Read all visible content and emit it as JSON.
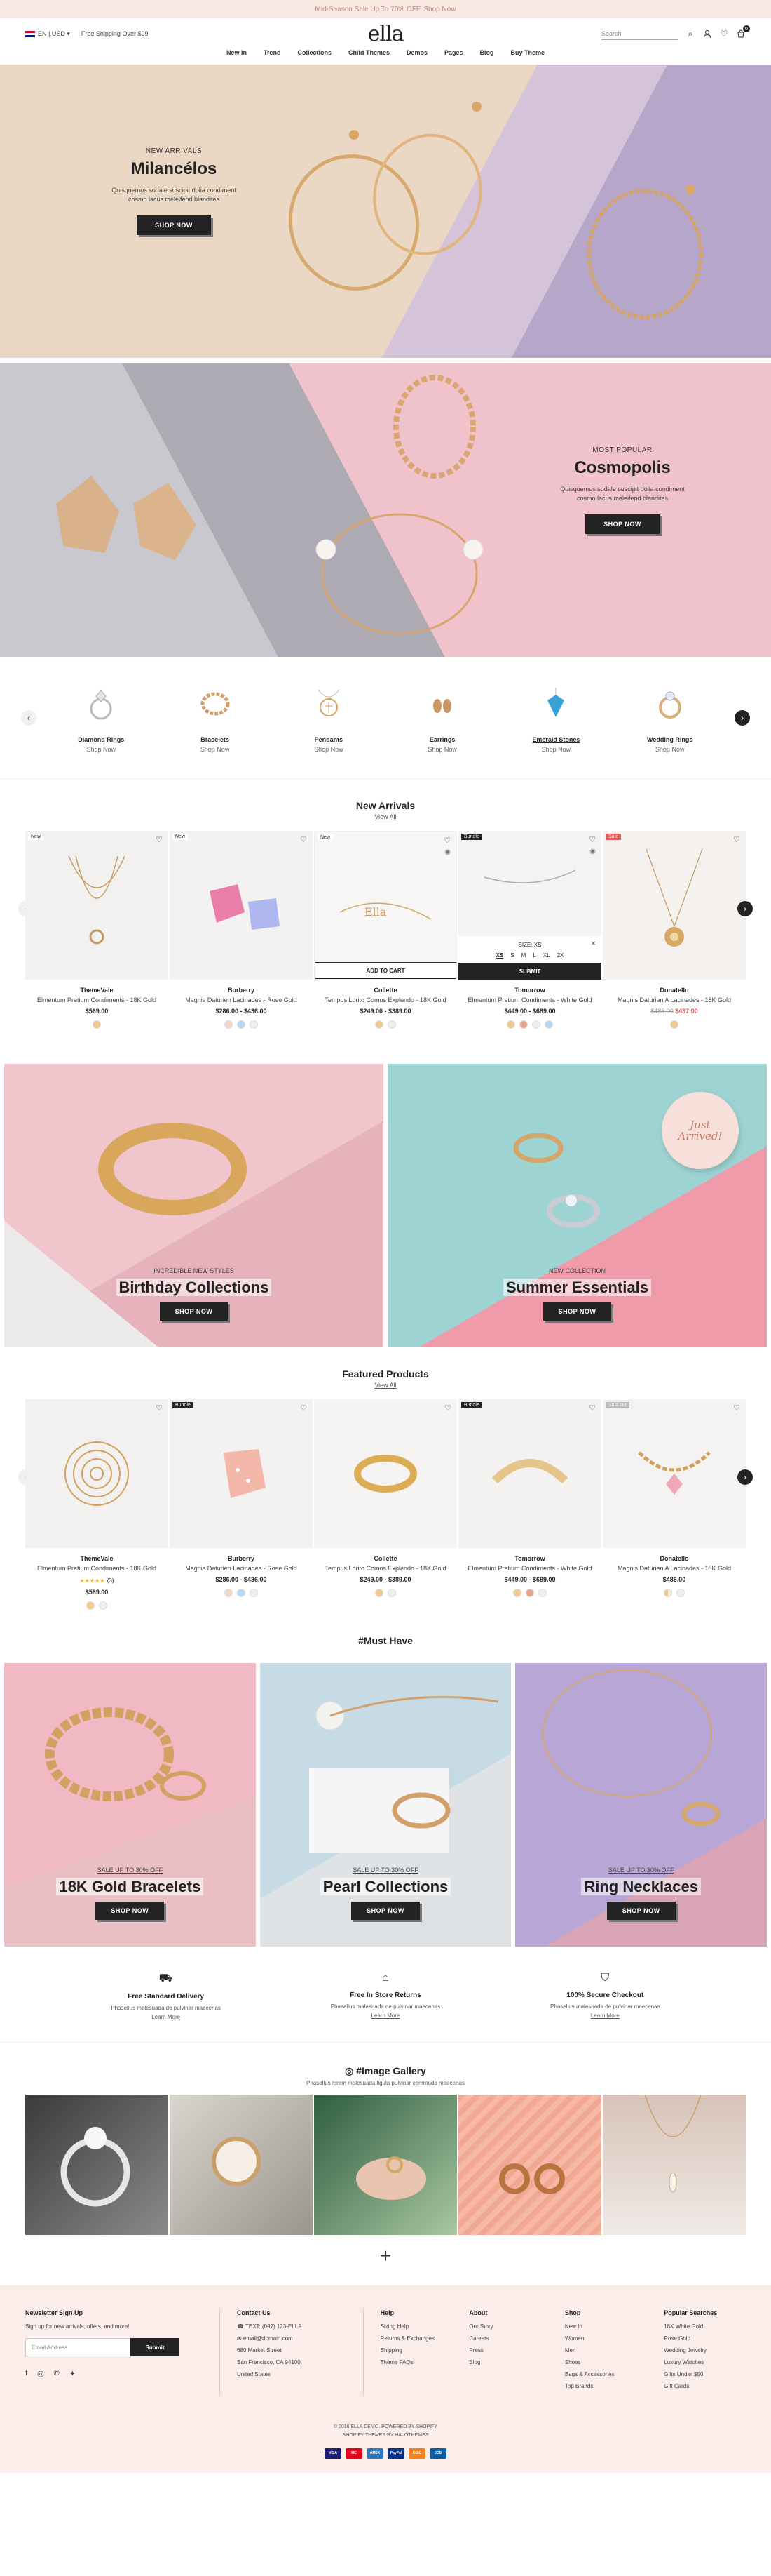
{
  "topbar": {
    "announcement": "Mid-Season Sale Up To 70% OFF. Shop Now"
  },
  "header": {
    "language": "EN",
    "currency": "USD",
    "shipping": "Free Shipping Over $99",
    "logo": "ella",
    "search_placeholder": "Search",
    "cart_count": "0"
  },
  "nav": [
    "New In",
    "Trend",
    "Collections",
    "Child Themes",
    "Demos",
    "Pages",
    "Blog",
    "Buy Theme"
  ],
  "hero1": {
    "sub": "NEW ARRIVALS",
    "title": "Milancélos",
    "text_line1": "Quisquemos sodale suscipit dolia condiment",
    "text_line2": "cosmo lacus meleifend blandites",
    "button": "SHOP NOW"
  },
  "hero2": {
    "sub": "MOST POPULAR",
    "title": "Cosmopolis",
    "text_line1": "Quisquemos sodale suscipit dolia condiment",
    "text_line2": "cosmo lacus meleifend blandites",
    "button": "SHOP NOW"
  },
  "categories": [
    {
      "name": "Diamond Rings",
      "link": "Shop Now"
    },
    {
      "name": "Bracelets",
      "link": "Shop Now"
    },
    {
      "name": "Pendants",
      "link": "Shop Now"
    },
    {
      "name": "Earrings",
      "link": "Shop Now"
    },
    {
      "name": "Emerald Stones",
      "link": "Shop Now"
    },
    {
      "name": "Wedding Rings",
      "link": "Shop Now"
    }
  ],
  "new_arrivals": {
    "title": "New Arrivals",
    "view_all": "View All",
    "products": [
      {
        "tag": "New",
        "vendor": "ThemeVale",
        "name": "Elmentum Pretium Condiments - 18K Gold",
        "price": "$569.00"
      },
      {
        "tag": "New",
        "vendor": "Burberry",
        "name": "Magnis Daturien Lacinades - Rose Gold",
        "price": "$286.00 - $436.00"
      },
      {
        "tag": "New",
        "vendor": "Collette",
        "name": "Tempus Lorito Comos Explendo - 18K Gold",
        "price": "$249.00 - $389.00",
        "add_to_cart": "ADD TO CART"
      },
      {
        "tag": "Bundle",
        "vendor": "Tomorrow",
        "name": "Elmentum Pretium Condiments - White Gold",
        "price": "$449.00 - $689.00",
        "size_label": "SIZE: XS",
        "sizes": [
          "XS",
          "S",
          "M",
          "L",
          "XL",
          "2X"
        ],
        "submit": "SUBMIT"
      },
      {
        "tag": "Sale",
        "vendor": "Donatello",
        "name": "Magnis Daturien A Lacinades - 18K Gold",
        "old_price": "$486.00",
        "sale_price": "$437.00"
      }
    ]
  },
  "banners": [
    {
      "sub": "INCREDIBLE NEW STYLES",
      "title": "Birthday Collections",
      "button": "SHOP NOW"
    },
    {
      "sub": "NEW COLLECTION",
      "title": "Summer Essentials",
      "button": "SHOP NOW",
      "stamp": "Just Arrived!"
    }
  ],
  "featured": {
    "title": "Featured Products",
    "view_all": "View All",
    "products": [
      {
        "tag": "",
        "vendor": "ThemeVale",
        "name": "Elmentum Pretium Condiments - 18K Gold",
        "price": "$569.00",
        "rating_count": "(3)"
      },
      {
        "tag": "Bundle",
        "vendor": "Burberry",
        "name": "Magnis Daturien Lacinades - Rose Gold",
        "price": "$286.00 - $436.00"
      },
      {
        "tag": "",
        "vendor": "Collette",
        "name": "Tempus Lorito Comos Explendo - 18K Gold",
        "price": "$249.00 - $389.00"
      },
      {
        "tag": "Bundle",
        "vendor": "Tomorrow",
        "name": "Elmentum Pretium Condiments - White Gold",
        "price": "$449.00 - $689.00"
      },
      {
        "tag": "Sold out",
        "vendor": "Donatello",
        "name": "Magnis Daturien A Lacinades - 18K Gold",
        "price": "$486.00"
      }
    ]
  },
  "must_have": {
    "title": "#Must Have",
    "items": [
      {
        "sub": "SALE UP TO 30% OFF",
        "title": "18K Gold Bracelets",
        "button": "SHOP NOW"
      },
      {
        "sub": "SALE UP TO 30% OFF",
        "title": "Pearl Collections",
        "button": "SHOP NOW"
      },
      {
        "sub": "SALE UP TO 30% OFF",
        "title": "Ring Necklaces",
        "button": "SHOP NOW"
      }
    ]
  },
  "features": [
    {
      "title": "Free Standard Delivery",
      "text": "Phasellus malesuada de pulvinar maecenas",
      "link": "Learn More"
    },
    {
      "title": "Free In Store Returns",
      "text": "Phasellus malesuada de pulvinar maecenas",
      "link": "Learn More"
    },
    {
      "title": "100% Secure Checkout",
      "text": "Phasellus malesuada de pulvinar maecenas",
      "link": "Learn More"
    }
  ],
  "gallery": {
    "title": "#Image Gallery",
    "text": "Phasellus lorem malesuada ligula pulvinar commodo maecenas"
  },
  "footer": {
    "newsletter": {
      "title": "Newsletter Sign Up",
      "text": "Sign up for new arrivals, offers, and more!",
      "placeholder": "Email Address",
      "button": "Submit"
    },
    "contact": {
      "title": "Contact Us",
      "phone": "TEXT: (097) 123-ELLA",
      "email": "email@domain.com",
      "addr1": "680 Market Street",
      "addr2": "San Francisco, CA 94100,",
      "addr3": "United States"
    },
    "help": {
      "title": "Help",
      "items": [
        "Sizing Help",
        "Returns & Exchanges",
        "Shipping",
        "Theme FAQs"
      ]
    },
    "about": {
      "title": "About",
      "items": [
        "Our Story",
        "Careers",
        "Press",
        "Blog"
      ]
    },
    "shop": {
      "title": "Shop",
      "items": [
        "New In",
        "Women",
        "Men",
        "Shoes",
        "Bags & Accessories",
        "Top Brands"
      ]
    },
    "popular": {
      "title": "Popular Searches",
      "items": [
        "18K White Gold",
        "Rose Gold",
        "Wedding Jewelry",
        "Luxury Watches",
        "Gifts Under $50",
        "Gift Cards"
      ]
    },
    "copy1": "© 2016 ELLA DEMO. POWERED BY SHOPIFY",
    "copy2": "SHOPIFY THEMES BY HALOTHEMES",
    "payments": [
      "VISA",
      "MC",
      "AMEX",
      "PayPal",
      "DISC",
      "JCB"
    ]
  },
  "colors": {
    "dark": "#232323",
    "sale": "#e05a5a",
    "pink_bg": "#fbeeea",
    "star": "#f5b400"
  }
}
